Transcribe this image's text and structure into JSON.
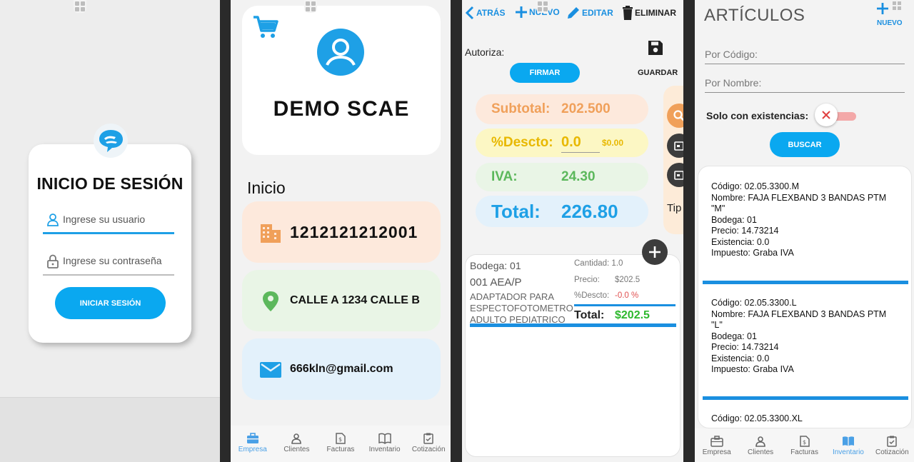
{
  "login": {
    "title": "INICIO DE SESIÓN",
    "user_placeholder": "Ingrese su usuario",
    "password_placeholder": "Ingrese su contraseña",
    "button": "INICIAR SESIÓN"
  },
  "empresa": {
    "name": "DEMO SCAE",
    "section": "Inicio",
    "ruc": "1212121212001",
    "address": "CALLE A 1234 CALLE B",
    "email": "666kln@gmail.com",
    "nav": [
      {
        "label": "Empresa",
        "icon": "briefcase-icon"
      },
      {
        "label": "Clientes",
        "icon": "person-icon"
      },
      {
        "label": "Facturas",
        "icon": "invoice-icon"
      },
      {
        "label": "Inventario",
        "icon": "book-icon"
      },
      {
        "label": "Cotización",
        "icon": "clipboard-icon"
      }
    ]
  },
  "factura": {
    "toolbar": {
      "back": "ATRÁS",
      "new": "NUEVO",
      "edit": "EDITAR",
      "delete": "ELIMINAR"
    },
    "autoriza_label": "Autoriza:",
    "firmar": "FIRMAR",
    "guardar": "GUARDAR",
    "subtotal_label": "Subtotal:",
    "subtotal_value": "202.500",
    "descto_label": "%Descto:",
    "descto_value": "0.0",
    "descto_amount": "$0.00",
    "iva_label": "IVA:",
    "iva_value": "24.30",
    "total_label": "Total:",
    "total_value": "226.80",
    "side_text": "Tip",
    "line": {
      "bodega": "Bodega: 01",
      "code": "001 AEA/P",
      "description_1": "ADAPTADOR PARA",
      "description_2": "ESPECTOFOTOMETRO",
      "description_3": "ADULTO PEDIATRICO",
      "cantidad": "Cantidad:  1.0",
      "precio_label": "Precio:",
      "precio_value": "$202.5",
      "descto_label": "%Descto:",
      "descto_value": "-0.0 %",
      "total_label": "Total:",
      "total_value": "$202.5"
    },
    "colors": {
      "subtotal": "#f0a05a",
      "descto": "#e8b800",
      "iva": "#5cb85c",
      "total": "#1ea0e6"
    }
  },
  "articulos": {
    "title": "ARTÍCULOS",
    "new_label": "NUEVO",
    "code_placeholder": "Por Código:",
    "name_placeholder": "Por Nombre:",
    "stock_label": "Solo con existencias:",
    "search_button": "BUSCAR",
    "items": [
      {
        "code": "Código: 02.05.3300.M",
        "name_1": "Nombre: FAJA FLEXBAND 3 BANDAS PTM",
        "name_2": "\"M\"",
        "bodega": "Bodega: 01",
        "precio": "Precio: 14.73214",
        "existencia": "Existencia: 0.0",
        "impuesto": "Impuesto: Graba IVA"
      },
      {
        "code": "Código: 02.05.3300.L",
        "name_1": "Nombre: FAJA FLEXBAND 3 BANDAS PTM",
        "name_2": "\"L\"",
        "bodega": "Bodega: 01",
        "precio": "Precio: 14.73214",
        "existencia": "Existencia: 0.0",
        "impuesto": "Impuesto: Graba IVA"
      },
      {
        "code": "Código: 02.05.3300.XL"
      }
    ],
    "nav": [
      {
        "label": "Empresa"
      },
      {
        "label": "Clientes"
      },
      {
        "label": "Facturas"
      },
      {
        "label": "Inventario"
      },
      {
        "label": "Cotización"
      }
    ],
    "active_nav": "Inventario"
  }
}
